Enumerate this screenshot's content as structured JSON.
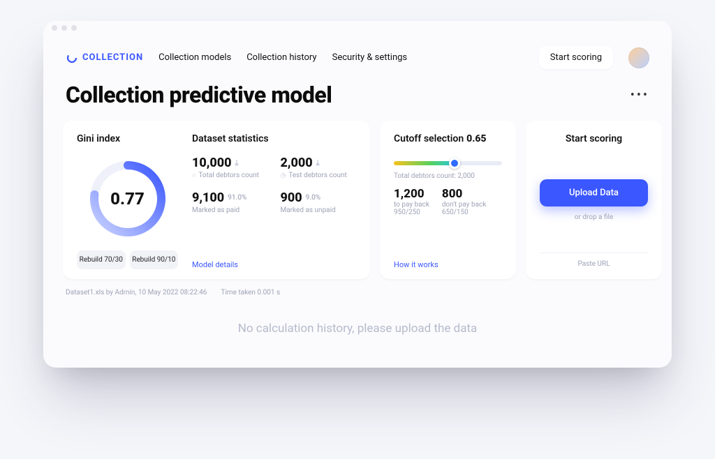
{
  "brand": "COLLECTION",
  "nav": {
    "collection_models": "Collection models",
    "collection_history": "Collection history",
    "security_settings": "Security & settings",
    "start_scoring_pill": "Start scoring"
  },
  "page_title": "Collection predictive model",
  "gini": {
    "title": "Gini index",
    "value": "0.77",
    "btn_7030": "Rebuild 70/30",
    "btn_9010": "Rebuild 90/10"
  },
  "dataset": {
    "title": "Dataset statistics",
    "total_debtors": "10,000",
    "total_debtors_lbl": "Total debtors count",
    "test_debtors": "2,000",
    "test_debtors_lbl": "Test debtors count",
    "marked_paid": "9,100",
    "marked_paid_pct": "91.0%",
    "marked_paid_lbl": "Marked as paid",
    "marked_unpaid": "900",
    "marked_unpaid_pct": "9.0%",
    "marked_unpaid_lbl": "Marked as unpaid",
    "model_details": "Model details"
  },
  "cutoff": {
    "title_pre": "Cutoff selection ",
    "title_val": "0.65",
    "debtors_line": "Total debtors count: 2,000",
    "pay_back": "1,200",
    "pay_back_lbl": "to pay back",
    "pay_back_split": "950/250",
    "dont_pay_back": "800",
    "dont_pay_back_lbl": "don't pay back",
    "dont_pay_back_split": "650/150",
    "how_link": "How it works"
  },
  "scoring": {
    "title": "Start scoring",
    "upload_btn": "Upload Data",
    "drop_hint": "or drop a file",
    "paste_url": "Paste URL"
  },
  "meta": {
    "file_info": "Dataset1.xls by Admin, 10 May 2022 08:22:46",
    "time_taken": "Time taken 0.001 s"
  },
  "empty_state": "No calculation history, please upload the data"
}
